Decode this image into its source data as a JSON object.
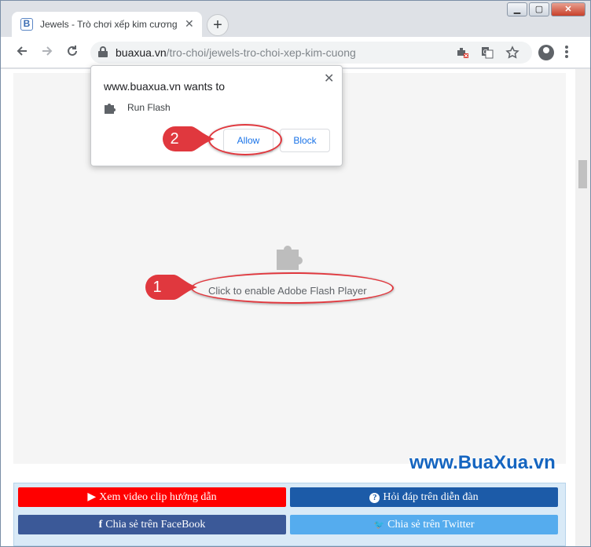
{
  "browser": {
    "tab": {
      "title": "Jewels - Trò chơi xếp kim cương",
      "favicon": "B",
      "close_label": "✕"
    },
    "new_tab_label": "+",
    "window_controls": {
      "minimize": "▁",
      "maximize": "▢",
      "close": "✕"
    },
    "url": {
      "host": "buaxua.vn",
      "path": "/tro-choi/jewels-tro-choi-xep-kim-cuong"
    },
    "icons": [
      "back-icon",
      "forward-icon",
      "reload-icon",
      "lock-icon",
      "flash-blocked-icon",
      "translate-icon",
      "star-icon",
      "account-icon",
      "menu-icon"
    ]
  },
  "popup": {
    "title": "www.buaxua.vn wants to",
    "permission": "Run Flash",
    "allow_label": "Allow",
    "block_label": "Block",
    "close_label": "✕"
  },
  "flash": {
    "enable_text": "Click to enable Adobe Flash Player"
  },
  "annotations": {
    "marker1": "1",
    "marker2": "2",
    "color": "#e0383e"
  },
  "watermark": "www.BuaXua.vn",
  "share": {
    "video": {
      "label": "Xem video clip hướng dẫn",
      "icon": "▶",
      "color": "#ff0000"
    },
    "forum": {
      "label": "Hỏi đáp trên diễn đàn",
      "icon": "?",
      "color": "#1c5ba8"
    },
    "facebook": {
      "label": "Chia sẻ trên FaceBook",
      "icon": "f",
      "color": "#3b5998"
    },
    "twitter": {
      "label": "Chia sẻ trên Twitter",
      "icon": "🐦",
      "color": "#55acee"
    }
  }
}
